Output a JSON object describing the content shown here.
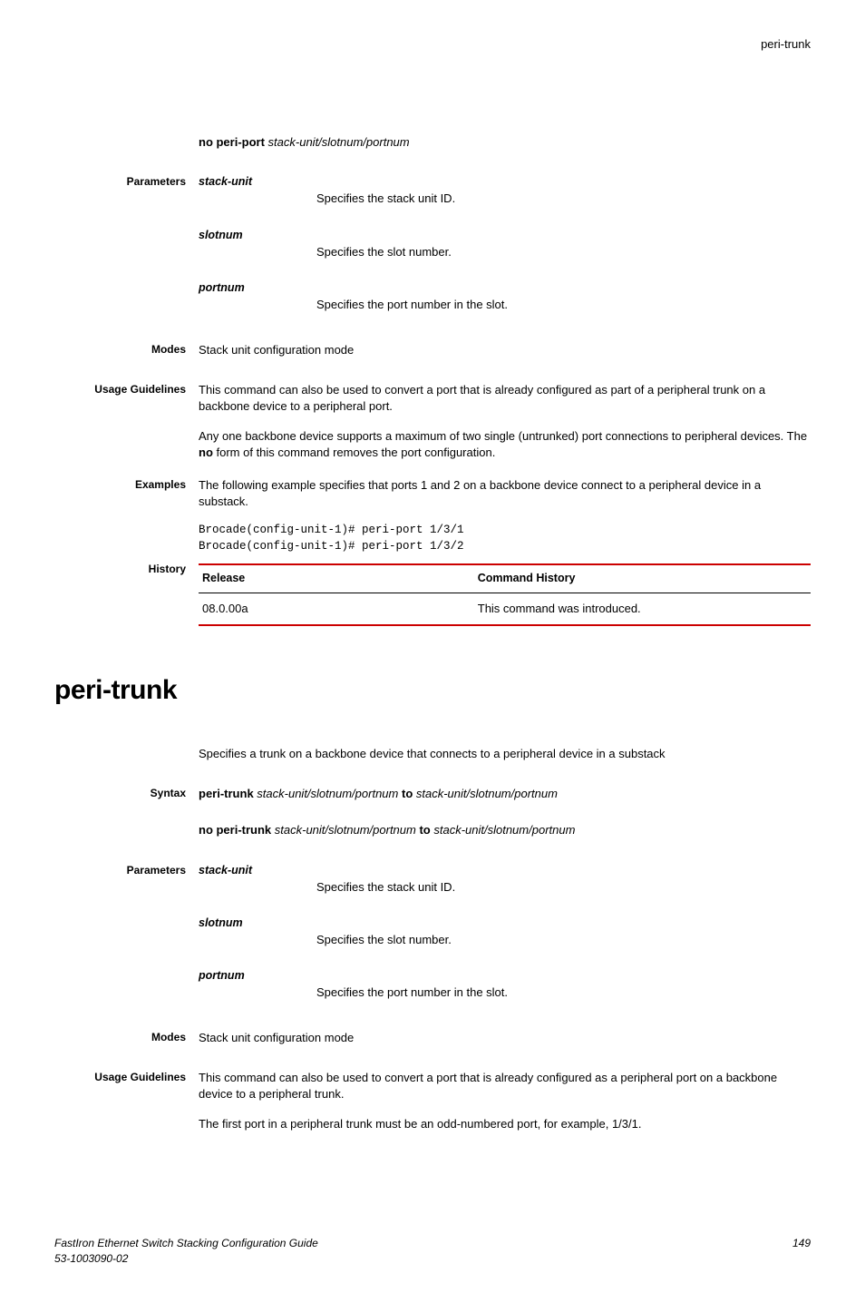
{
  "header": {
    "running_title": "peri-trunk"
  },
  "cmd1": {
    "no_form": {
      "prefix": "no peri-port ",
      "args": "stack-unit/slotnum/portnum"
    },
    "labels": {
      "parameters": "Parameters",
      "modes": "Modes",
      "usage": "Usage Guidelines",
      "examples": "Examples",
      "history": "History"
    },
    "params": [
      {
        "name": "stack-unit",
        "desc": "Specifies the stack unit ID."
      },
      {
        "name": "slotnum",
        "desc": "Specifies the slot number."
      },
      {
        "name": "portnum",
        "desc": "Specifies the port number in the slot."
      }
    ],
    "modes": "Stack unit configuration mode",
    "usage_p1": "This command can also be used to convert a port that is already configured as part of a peripheral trunk on a backbone device to a peripheral port.",
    "usage_p2_a": "Any one backbone device supports a maximum of two single (untrunked) port connections to peripheral devices. The ",
    "usage_p2_b": "no",
    "usage_p2_c": " form of this command removes the port configuration.",
    "examples_intro": "The following example specifies that ports 1 and 2 on a backbone device connect to a peripheral device in a substack.",
    "examples_code": "Brocade(config-unit-1)# peri-port 1/3/1\nBrocade(config-unit-1)# peri-port 1/3/2",
    "history_headers": {
      "release": "Release",
      "cmdhist": "Command History"
    },
    "history_rows": [
      {
        "release": "08.0.00a",
        "desc": "This command was introduced."
      }
    ]
  },
  "cmd2": {
    "title": "peri-trunk",
    "summary": "Specifies a trunk on a backbone device that connects to a peripheral device in a substack",
    "labels": {
      "syntax": "Syntax",
      "parameters": "Parameters",
      "modes": "Modes",
      "usage": "Usage Guidelines"
    },
    "syntax": {
      "cmd": "peri-trunk ",
      "arg1": "stack-unit/slotnum/portnum",
      "to": " to ",
      "arg2": "stack-unit/slotnum/portnum",
      "no_cmd": "no peri-trunk ",
      "no_arg1": "stack-unit/slotnum/portnum",
      "no_to": " to ",
      "no_arg2": "stack-unit/slotnum/portnum"
    },
    "params": [
      {
        "name": "stack-unit",
        "desc": "Specifies the stack unit ID."
      },
      {
        "name": "slotnum",
        "desc": "Specifies the slot number."
      },
      {
        "name": "portnum",
        "desc": "Specifies the port number in the slot."
      }
    ],
    "modes": "Stack unit configuration mode",
    "usage_p1": "This command can also be used to convert a port that is already configured as a peripheral port on a backbone device to a peripheral trunk.",
    "usage_p2": "The first port in a peripheral trunk must be an odd-numbered port, for example, 1/3/1."
  },
  "footer": {
    "left_line1": "FastIron Ethernet Switch Stacking Configuration Guide",
    "left_line2": "53-1003090-02",
    "page": "149"
  }
}
